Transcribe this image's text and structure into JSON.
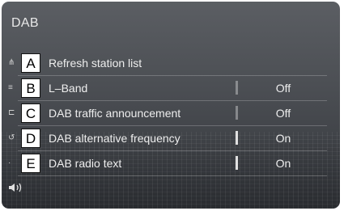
{
  "screen": {
    "title": "DAB"
  },
  "items": [
    {
      "letter": "A",
      "label": "Refresh station list",
      "value": "",
      "icon": "antenna-icon"
    },
    {
      "letter": "B",
      "label": "L–Band",
      "value": "Off",
      "icon": "list-icon"
    },
    {
      "letter": "C",
      "label": "DAB traffic announcement",
      "value": "Off",
      "icon": "traffic-icon"
    },
    {
      "letter": "D",
      "label": "DAB alternative frequency",
      "value": "On",
      "icon": "refresh-icon"
    },
    {
      "letter": "E",
      "label": "DAB radio text",
      "value": "On",
      "icon": "dot-icon"
    }
  ],
  "footer": {
    "icon": "volume-icon"
  }
}
